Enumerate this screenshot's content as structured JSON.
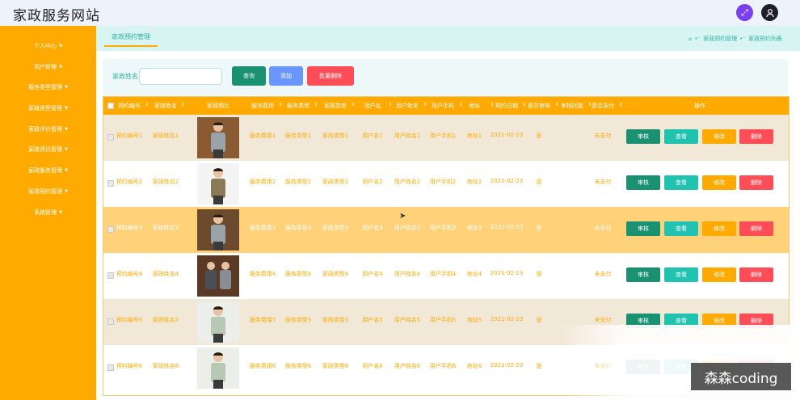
{
  "header": {
    "site_title": "家政服务网站"
  },
  "sidebar": {
    "items": [
      {
        "label": "个人中心"
      },
      {
        "label": "用户管理"
      },
      {
        "label": "服务类型管理"
      },
      {
        "label": "家政类型管理"
      },
      {
        "label": "家政评价管理"
      },
      {
        "label": "家政资讯管理"
      },
      {
        "label": "家政服务管理"
      },
      {
        "label": "家政预约管理"
      },
      {
        "label": "系统管理"
      }
    ]
  },
  "tabs": {
    "active": "家政预约管理"
  },
  "breadcrumb": {
    "level1": "家政预约管理",
    "level2": "家政预约列表"
  },
  "search": {
    "label": "家政姓名",
    "value": "",
    "placeholder": ""
  },
  "toolbar": {
    "query": "查询",
    "add": "添加",
    "batch_delete": "批量删除"
  },
  "table": {
    "columns": [
      "预约编号",
      "家政姓名",
      "家政图片",
      "服务费用",
      "服务类型",
      "家政类型",
      "用户名",
      "用户姓名",
      "用户手机",
      "地址",
      "预约日期",
      "是否审核",
      "审核回复",
      "是否支付",
      "操作"
    ],
    "actions": {
      "review": "审核",
      "view": "查看",
      "edit": "修改",
      "delete": "删除"
    },
    "rows": [
      {
        "id": "预约编号1",
        "name": "家政姓名1",
        "fee": "服务费用1",
        "service": "服务类型1",
        "type": "家政类型1",
        "user": "用户名1",
        "uname": "用户姓名1",
        "phone": "用户手机1",
        "addr": "地址1",
        "date": "2021-02-23",
        "audit": "是",
        "reply": "",
        "paid": "未支付"
      },
      {
        "id": "预约编号2",
        "name": "家政姓名2",
        "fee": "服务费用2",
        "service": "服务类型2",
        "type": "家政类型2",
        "user": "用户名2",
        "uname": "用户姓名2",
        "phone": "用户手机2",
        "addr": "地址2",
        "date": "2021-02-23",
        "audit": "是",
        "reply": "",
        "paid": "未支付"
      },
      {
        "id": "预约编号3",
        "name": "家政姓名3",
        "fee": "服务费用3",
        "service": "服务类型3",
        "type": "家政类型3",
        "user": "用户名3",
        "uname": "用户姓名3",
        "phone": "用户手机3",
        "addr": "地址3",
        "date": "2021-02-23",
        "audit": "是",
        "reply": "",
        "paid": "未支付"
      },
      {
        "id": "预约编号4",
        "name": "家政姓名4",
        "fee": "服务费用4",
        "service": "服务类型4",
        "type": "家政类型4",
        "user": "用户名4",
        "uname": "用户姓名4",
        "phone": "用户手机4",
        "addr": "地址4",
        "date": "2021-02-23",
        "audit": "是",
        "reply": "",
        "paid": "未支付"
      },
      {
        "id": "预约编号5",
        "name": "家政姓名5",
        "fee": "服务费用5",
        "service": "服务类型5",
        "type": "家政类型5",
        "user": "用户名5",
        "uname": "用户姓名5",
        "phone": "用户手机5",
        "addr": "地址5",
        "date": "2021-02-23",
        "audit": "是",
        "reply": "",
        "paid": "未支付"
      },
      {
        "id": "预约编号6",
        "name": "家政姓名6",
        "fee": "服务费用6",
        "service": "服务类型6",
        "type": "家政类型6",
        "user": "用户名6",
        "uname": "用户姓名6",
        "phone": "用户手机6",
        "addr": "地址6",
        "date": "2021-02-23",
        "audit": "是",
        "reply": "",
        "paid": "未支付"
      }
    ]
  },
  "watermark": "森森coding",
  "colors": {
    "accent": "#ffaa00",
    "teal": "#2bb3a3",
    "stripe": "#f2e8d8",
    "hover": "#ffd27a",
    "text_orange": "#ffaa00",
    "white_row_text": "#ffaa00"
  }
}
